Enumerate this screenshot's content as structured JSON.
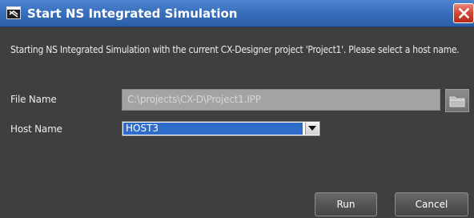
{
  "dialog": {
    "title": "Start NS Integrated Simulation",
    "message": "Starting NS Integrated Simulation with the current CX-Designer project 'Project1'. Please select a host name."
  },
  "form": {
    "file_name_label": "File Name",
    "file_name_value": "C:\\projects\\CX-D\\Project1.IPP",
    "host_name_label": "Host Name",
    "host_name_value": "HOST3"
  },
  "buttons": {
    "run": "Run",
    "cancel": "Cancel"
  },
  "colors": {
    "titlebar": "#3a70bd",
    "body": "#3f3f3f",
    "close": "#d34b3a",
    "selection": "#2f6bc8"
  },
  "icons": {
    "app": "simulation-window-icon",
    "close": "close-icon",
    "browse": "folder-icon",
    "dropdown": "chevron-down-icon"
  }
}
